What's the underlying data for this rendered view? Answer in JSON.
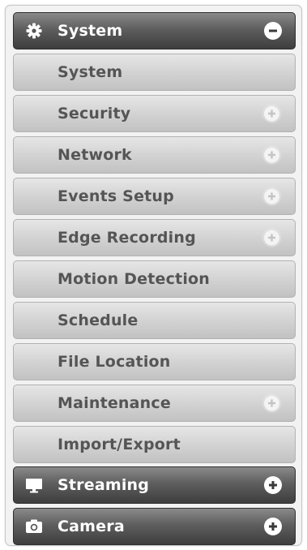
{
  "menu": {
    "system": {
      "label": "System",
      "icon": "gear-icon",
      "state": "expanded"
    },
    "system_items": [
      {
        "label": "System",
        "expandable": false
      },
      {
        "label": "Security",
        "expandable": true
      },
      {
        "label": "Network",
        "expandable": true
      },
      {
        "label": "Events Setup",
        "expandable": true
      },
      {
        "label": "Edge Recording",
        "expandable": true
      },
      {
        "label": "Motion Detection",
        "expandable": false
      },
      {
        "label": "Schedule",
        "expandable": false
      },
      {
        "label": "File Location",
        "expandable": false
      },
      {
        "label": "Maintenance",
        "expandable": true
      },
      {
        "label": "Import/Export",
        "expandable": false
      }
    ],
    "streaming": {
      "label": "Streaming",
      "icon": "monitor-icon",
      "state": "collapsed"
    },
    "camera": {
      "label": "Camera",
      "icon": "camera-icon",
      "state": "collapsed"
    }
  },
  "colors": {
    "header_text": "#ffffff",
    "item_text": "#555555",
    "header_dark": "#3e3e3e",
    "item_light": "#d3d3d3"
  }
}
